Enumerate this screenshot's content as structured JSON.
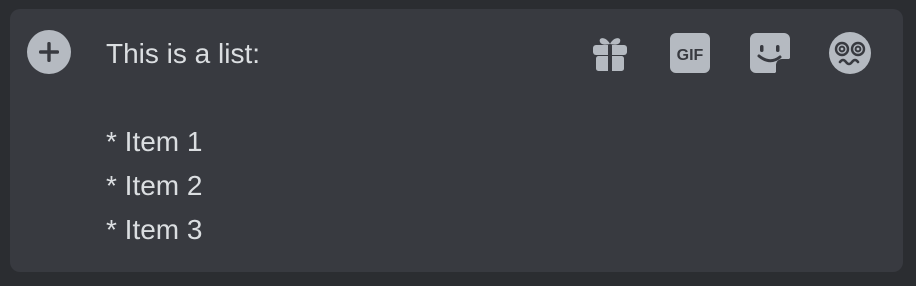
{
  "composer": {
    "lines": [
      "This is a list:",
      "",
      "* Item 1",
      "* Item 2",
      "* Item 3"
    ]
  },
  "icons": {
    "attach": "plus-circle-icon",
    "gift": "gift-icon",
    "gif": "gif-icon",
    "sticker": "sticker-icon",
    "emoji": "emoji-icon"
  },
  "gif_label": "GIF",
  "colors": {
    "background": "#2b2d31",
    "composer": "#383a40",
    "icon": "#b5bac1",
    "text": "#dbdee1"
  }
}
